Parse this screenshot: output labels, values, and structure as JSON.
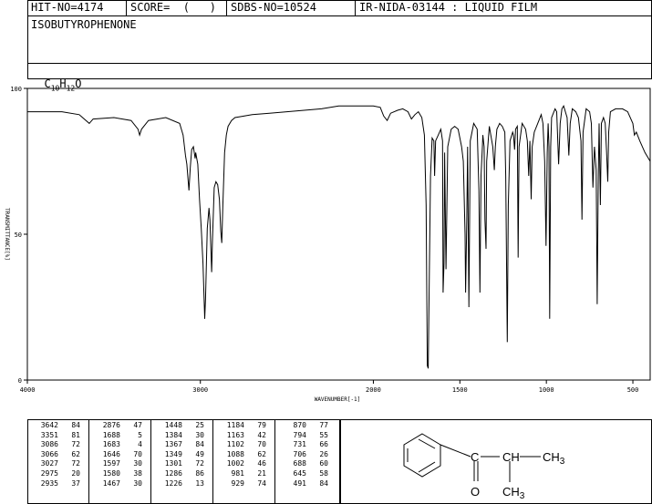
{
  "header": {
    "hit": "HIT-NO=4174",
    "score": "SCORE=  (   )",
    "sdbs": "SDBS-NO=10524",
    "ir": "IR-NIDA-03144 : LIQUID FILM"
  },
  "compound_name": "ISOBUTYROPHENONE",
  "formula": {
    "c": "C",
    "c_n": "10",
    "h": "H",
    "h_n": "12",
    "o": "O"
  },
  "structure_labels": {
    "ch3_top": "CH3",
    "ch3_bottom": "CH3",
    "oxygen": "O"
  },
  "chart_data": {
    "type": "line",
    "title": "",
    "xlabel": "WAVENUMBER[-1]",
    "ylabel": "TRANSMITTANCE[%]",
    "xlim": [
      4000,
      400
    ],
    "ylim": [
      0,
      100
    ],
    "x_ticks": [
      {
        "value": 4000,
        "label": "4000"
      },
      {
        "value": 3000,
        "label": "3000"
      },
      {
        "value": 2000,
        "label": "2000"
      },
      {
        "value": 1500,
        "label": "1500"
      },
      {
        "value": 1000,
        "label": "1000"
      },
      {
        "value": 500,
        "label": "500"
      }
    ],
    "y_ticks": [
      {
        "value": 100,
        "label": "100"
      },
      {
        "value": 50,
        "label": "50"
      },
      {
        "value": 0,
        "label": "0"
      }
    ],
    "series": [
      {
        "points": [
          [
            4000,
            92
          ],
          [
            3800,
            92
          ],
          [
            3700,
            91
          ],
          [
            3642,
            88
          ],
          [
            3620,
            89.5
          ],
          [
            3500,
            90
          ],
          [
            3400,
            89
          ],
          [
            3360,
            86
          ],
          [
            3351,
            84
          ],
          [
            3340,
            86
          ],
          [
            3300,
            89
          ],
          [
            3200,
            90
          ],
          [
            3120,
            88
          ],
          [
            3100,
            84
          ],
          [
            3086,
            77
          ],
          [
            3078,
            74
          ],
          [
            3066,
            65
          ],
          [
            3058,
            73
          ],
          [
            3050,
            79
          ],
          [
            3040,
            80
          ],
          [
            3030,
            76
          ],
          [
            3027,
            78
          ],
          [
            3015,
            74
          ],
          [
            3005,
            62
          ],
          [
            2995,
            52
          ],
          [
            2985,
            40
          ],
          [
            2975,
            21
          ],
          [
            2970,
            28
          ],
          [
            2960,
            52
          ],
          [
            2950,
            59
          ],
          [
            2945,
            55
          ],
          [
            2935,
            37
          ],
          [
            2930,
            48
          ],
          [
            2920,
            66
          ],
          [
            2910,
            68
          ],
          [
            2900,
            67
          ],
          [
            2890,
            62
          ],
          [
            2882,
            51
          ],
          [
            2876,
            47
          ],
          [
            2870,
            60
          ],
          [
            2860,
            78
          ],
          [
            2850,
            84
          ],
          [
            2840,
            87
          ],
          [
            2820,
            89
          ],
          [
            2800,
            90
          ],
          [
            2700,
            91
          ],
          [
            2600,
            91.5
          ],
          [
            2500,
            92
          ],
          [
            2400,
            92.5
          ],
          [
            2300,
            93
          ],
          [
            2200,
            94
          ],
          [
            2100,
            94
          ],
          [
            2000,
            94
          ],
          [
            1960,
            93.5
          ],
          [
            1940,
            90.5
          ],
          [
            1920,
            89
          ],
          [
            1900,
            91.5
          ],
          [
            1860,
            92.5
          ],
          [
            1830,
            93
          ],
          [
            1800,
            92
          ],
          [
            1780,
            89.5
          ],
          [
            1760,
            91
          ],
          [
            1740,
            92
          ],
          [
            1720,
            90
          ],
          [
            1705,
            84
          ],
          [
            1695,
            60
          ],
          [
            1688,
            5
          ],
          [
            1683,
            4
          ],
          [
            1680,
            20
          ],
          [
            1670,
            70
          ],
          [
            1660,
            83
          ],
          [
            1650,
            82
          ],
          [
            1646,
            70
          ],
          [
            1640,
            82
          ],
          [
            1625,
            84
          ],
          [
            1610,
            86
          ],
          [
            1600,
            82
          ],
          [
            1597,
            30
          ],
          [
            1592,
            40
          ],
          [
            1588,
            78
          ],
          [
            1580,
            38
          ],
          [
            1575,
            60
          ],
          [
            1570,
            80
          ],
          [
            1550,
            86
          ],
          [
            1530,
            87
          ],
          [
            1510,
            86
          ],
          [
            1490,
            80
          ],
          [
            1480,
            75
          ],
          [
            1470,
            50
          ],
          [
            1467,
            30
          ],
          [
            1460,
            55
          ],
          [
            1455,
            80
          ],
          [
            1448,
            25
          ],
          [
            1440,
            82
          ],
          [
            1420,
            88
          ],
          [
            1400,
            86
          ],
          [
            1390,
            65
          ],
          [
            1384,
            30
          ],
          [
            1378,
            70
          ],
          [
            1370,
            80
          ],
          [
            1367,
            84
          ],
          [
            1360,
            80
          ],
          [
            1355,
            55
          ],
          [
            1349,
            45
          ],
          [
            1345,
            75
          ],
          [
            1330,
            87
          ],
          [
            1310,
            80
          ],
          [
            1301,
            72
          ],
          [
            1295,
            80
          ],
          [
            1286,
            86
          ],
          [
            1270,
            88
          ],
          [
            1255,
            87
          ],
          [
            1240,
            85
          ],
          [
            1235,
            70
          ],
          [
            1226,
            13
          ],
          [
            1220,
            60
          ],
          [
            1210,
            82
          ],
          [
            1195,
            85
          ],
          [
            1190,
            84
          ],
          [
            1184,
            79
          ],
          [
            1178,
            86
          ],
          [
            1168,
            87
          ],
          [
            1163,
            42
          ],
          [
            1158,
            80
          ],
          [
            1140,
            88
          ],
          [
            1120,
            86
          ],
          [
            1110,
            82
          ],
          [
            1102,
            70
          ],
          [
            1095,
            82
          ],
          [
            1088,
            62
          ],
          [
            1082,
            80
          ],
          [
            1070,
            85
          ],
          [
            1050,
            88
          ],
          [
            1030,
            91
          ],
          [
            1020,
            88
          ],
          [
            1010,
            75
          ],
          [
            1002,
            46
          ],
          [
            995,
            78
          ],
          [
            990,
            88
          ],
          [
            985,
            80
          ],
          [
            981,
            21
          ],
          [
            975,
            80
          ],
          [
            970,
            90
          ],
          [
            950,
            93
          ],
          [
            940,
            92
          ],
          [
            929,
            74
          ],
          [
            920,
            88
          ],
          [
            910,
            93
          ],
          [
            900,
            94
          ],
          [
            880,
            90
          ],
          [
            870,
            77
          ],
          [
            862,
            88
          ],
          [
            850,
            93
          ],
          [
            830,
            92
          ],
          [
            815,
            90
          ],
          [
            800,
            82
          ],
          [
            794,
            55
          ],
          [
            788,
            85
          ],
          [
            770,
            93
          ],
          [
            750,
            92
          ],
          [
            740,
            88
          ],
          [
            731,
            66
          ],
          [
            722,
            80
          ],
          [
            712,
            72
          ],
          [
            706,
            26
          ],
          [
            700,
            70
          ],
          [
            695,
            88
          ],
          [
            688,
            60
          ],
          [
            682,
            88
          ],
          [
            670,
            90
          ],
          [
            660,
            88
          ],
          [
            652,
            78
          ],
          [
            645,
            68
          ],
          [
            640,
            85
          ],
          [
            630,
            92
          ],
          [
            600,
            93
          ],
          [
            560,
            93
          ],
          [
            530,
            92
          ],
          [
            500,
            88
          ],
          [
            491,
            84
          ],
          [
            480,
            85
          ],
          [
            460,
            82
          ],
          [
            430,
            78
          ],
          [
            410,
            76
          ],
          [
            400,
            75
          ]
        ]
      }
    ]
  },
  "peaks": {
    "columns": [
      [
        [
          "3642",
          "84"
        ],
        [
          "3351",
          "81"
        ],
        [
          "3086",
          "72"
        ],
        [
          "3066",
          "62"
        ],
        [
          "3027",
          "72"
        ],
        [
          "2975",
          "20"
        ],
        [
          "2935",
          "37"
        ]
      ],
      [
        [
          "2876",
          "47"
        ],
        [
          "1688",
          "5"
        ],
        [
          "1683",
          "4"
        ],
        [
          "1646",
          "70"
        ],
        [
          "1597",
          "30"
        ],
        [
          "1580",
          "38"
        ],
        [
          "1467",
          "30"
        ]
      ],
      [
        [
          "1448",
          "25"
        ],
        [
          "1384",
          "30"
        ],
        [
          "1367",
          "84"
        ],
        [
          "1349",
          "49"
        ],
        [
          "1301",
          "72"
        ],
        [
          "1286",
          "86"
        ],
        [
          "1226",
          "13"
        ]
      ],
      [
        [
          "1184",
          "79"
        ],
        [
          "1163",
          "42"
        ],
        [
          "1102",
          "70"
        ],
        [
          "1088",
          "62"
        ],
        [
          "1002",
          "46"
        ],
        [
          "981",
          "21"
        ],
        [
          "929",
          "74"
        ]
      ],
      [
        [
          "870",
          "77"
        ],
        [
          "794",
          "55"
        ],
        [
          "731",
          "66"
        ],
        [
          "706",
          "26"
        ],
        [
          "688",
          "60"
        ],
        [
          "645",
          "58"
        ],
        [
          "491",
          "84"
        ]
      ]
    ]
  }
}
